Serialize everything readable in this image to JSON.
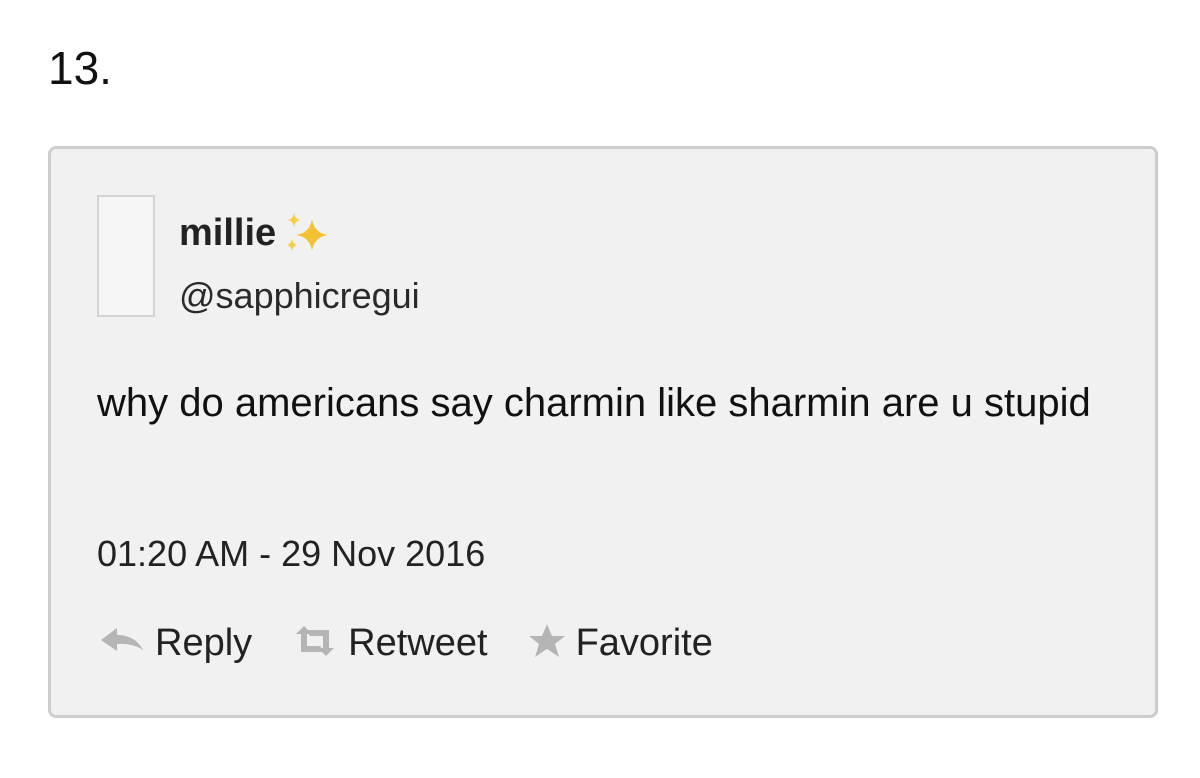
{
  "item_number": "13.",
  "tweet": {
    "display_name": "millie",
    "handle": "@sapphicregui",
    "text": "why do americans say charmin like sharmin are u stupid",
    "timestamp": "01:20 AM - 29 Nov 2016",
    "actions": {
      "reply_label": "Reply",
      "retweet_label": "Retweet",
      "favorite_label": "Favorite"
    }
  },
  "icons": {
    "name_decoration": "sparkles-icon",
    "reply": "reply-arrow-icon",
    "retweet": "retweet-icon",
    "favorite": "star-icon"
  },
  "colors": {
    "card_background": "#f1f1f1",
    "card_border": "#cdcdcd",
    "action_icon": "#b5b5b5",
    "sparkles": "#f2c230"
  }
}
